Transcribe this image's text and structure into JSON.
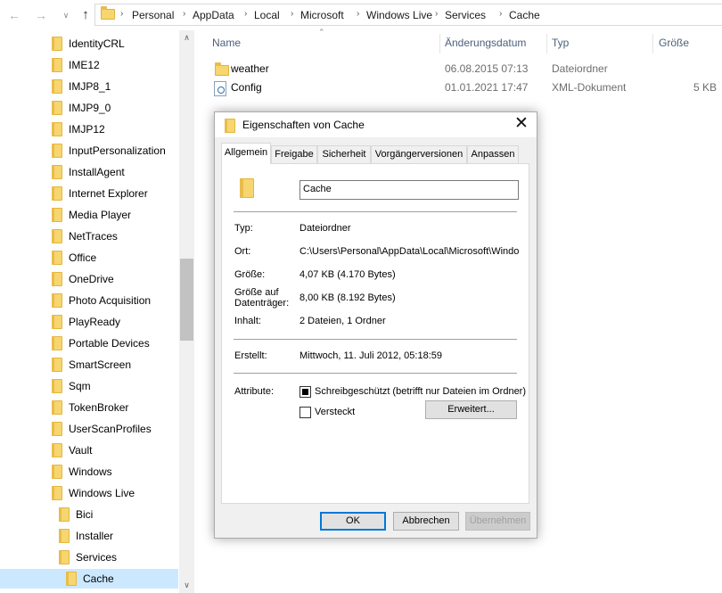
{
  "address_bar": {
    "breadcrumbs": [
      "Personal",
      "AppData",
      "Local",
      "Microsoft",
      "Windows Live",
      "Services",
      "Cache"
    ]
  },
  "nav_pane": {
    "items": [
      {
        "label": "IdentityCRL",
        "level": 0
      },
      {
        "label": "IME12",
        "level": 0
      },
      {
        "label": "IMJP8_1",
        "level": 0
      },
      {
        "label": "IMJP9_0",
        "level": 0
      },
      {
        "label": "IMJP12",
        "level": 0
      },
      {
        "label": "InputPersonalization",
        "level": 0
      },
      {
        "label": "InstallAgent",
        "level": 0
      },
      {
        "label": "Internet Explorer",
        "level": 0
      },
      {
        "label": "Media Player",
        "level": 0
      },
      {
        "label": "NetTraces",
        "level": 0
      },
      {
        "label": "Office",
        "level": 0
      },
      {
        "label": "OneDrive",
        "level": 0
      },
      {
        "label": "Photo Acquisition",
        "level": 0
      },
      {
        "label": "PlayReady",
        "level": 0
      },
      {
        "label": "Portable Devices",
        "level": 0
      },
      {
        "label": "SmartScreen",
        "level": 0
      },
      {
        "label": "Sqm",
        "level": 0
      },
      {
        "label": "TokenBroker",
        "level": 0
      },
      {
        "label": "UserScanProfiles",
        "level": 0
      },
      {
        "label": "Vault",
        "level": 0
      },
      {
        "label": "Windows",
        "level": 0
      },
      {
        "label": "Windows Live",
        "level": 0
      },
      {
        "label": "Bici",
        "level": 1
      },
      {
        "label": "Installer",
        "level": 1
      },
      {
        "label": "Services",
        "level": 1
      },
      {
        "label": "Cache",
        "level": 2,
        "selected": true
      }
    ]
  },
  "file_list": {
    "columns": {
      "name": "Name",
      "date": "Änderungsdatum",
      "type": "Typ",
      "size": "Größe"
    },
    "rows": [
      {
        "name": "weather",
        "date": "06.08.2015 07:13",
        "type": "Dateiordner",
        "size": "",
        "icon": "folder-icon"
      },
      {
        "name": "Config",
        "date": "01.01.2021 17:47",
        "type": "XML-Dokument",
        "size": "5 KB",
        "icon": "xml-file-icon"
      }
    ]
  },
  "dialog": {
    "title": "Eigenschaften von Cache",
    "tabs": [
      "Allgemein",
      "Freigabe",
      "Sicherheit",
      "Vorgängerversionen",
      "Anpassen"
    ],
    "active_tab": "Allgemein",
    "name_value": "Cache",
    "props": {
      "type_label": "Typ:",
      "type_value": "Dateiordner",
      "location_label": "Ort:",
      "location_value": "C:\\Users\\Personal\\AppData\\Local\\Microsoft\\Windows Live\\Services",
      "size_label": "Größe:",
      "size_value": "4,07 KB (4.170 Bytes)",
      "disk_label_1": "Größe auf",
      "disk_label_2": "Datenträger:",
      "disk_value": "8,00 KB (8.192 Bytes)",
      "contents_label": "Inhalt:",
      "contents_value": "2 Dateien, 1 Ordner",
      "created_label": "Erstellt:",
      "created_value": "Mittwoch, 11. Juli 2012, 05:18:59",
      "attributes_label": "Attribute:"
    },
    "attributes": {
      "readonly_label": "Schreibgeschützt (betrifft nur Dateien im Ordner)",
      "hidden_label": "Versteckt",
      "advanced_label": "Erweitert..."
    },
    "buttons": {
      "ok": "OK",
      "cancel": "Abbrechen",
      "apply": "Übernehmen"
    }
  },
  "colors": {
    "selection": "#cce8ff",
    "folder": "#f7d66f",
    "header_text": "#4c607a",
    "default_button_border": "#0078d7"
  }
}
